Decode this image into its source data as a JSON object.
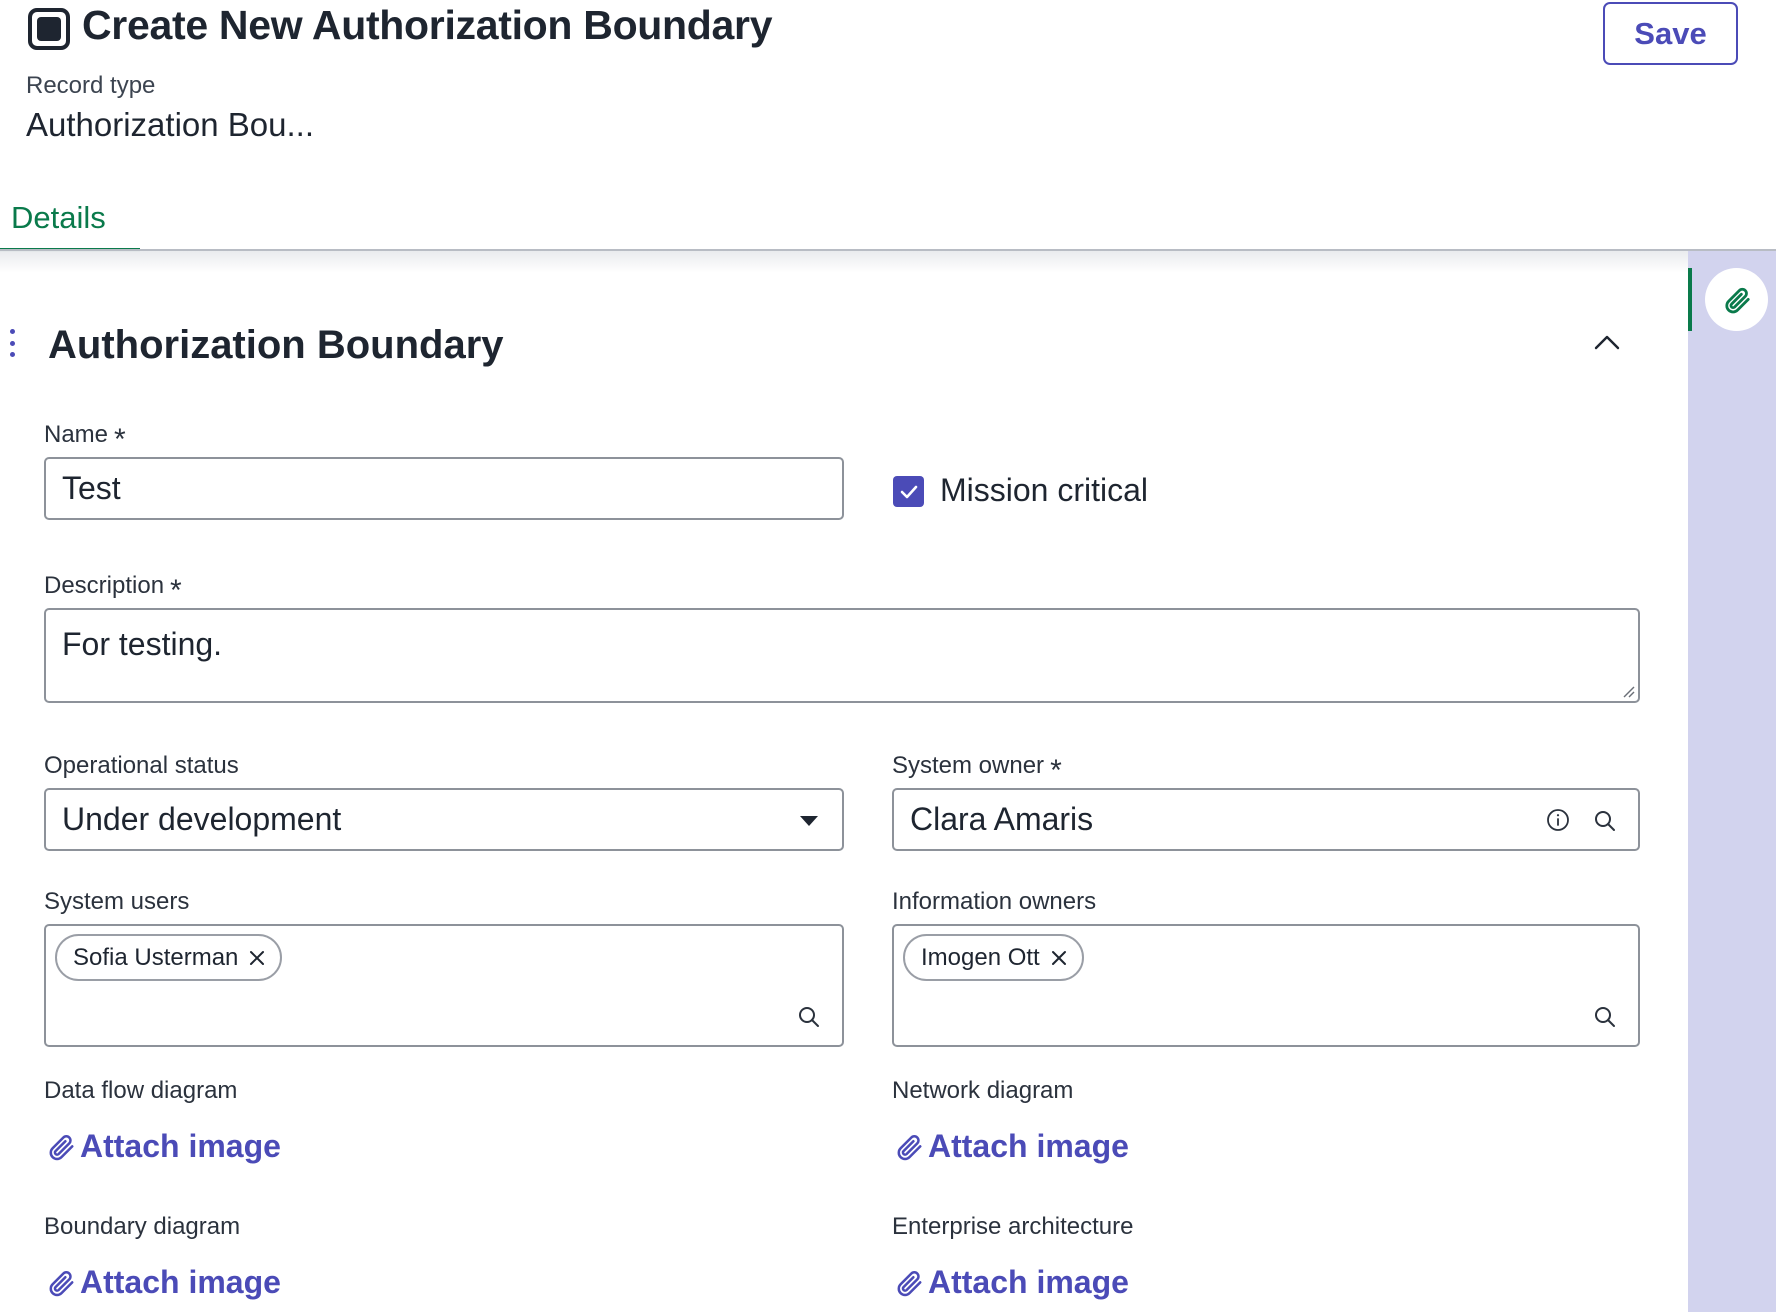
{
  "header": {
    "title": "Create New Authorization Boundary",
    "record_type_label": "Record type",
    "record_type_value": "Authorization Bou...",
    "save_label": "Save",
    "icon": "record-icon"
  },
  "tabs": [
    {
      "label": "Details",
      "active": true
    }
  ],
  "right_rail": {
    "icon": "paperclip-icon"
  },
  "section": {
    "title": "Authorization Boundary",
    "collapse_icon": "chevron-up-icon",
    "fields": {
      "name": {
        "label": "Name",
        "required_mark": "*",
        "value": "Test"
      },
      "mission_critical": {
        "label": "Mission critical",
        "checked": true
      },
      "description": {
        "label": "Description",
        "required_mark": "*",
        "value": "For testing."
      },
      "operational_status": {
        "label": "Operational status",
        "value": "Under development"
      },
      "system_owner": {
        "label": "System owner",
        "required_mark": "*",
        "value": "Clara Amaris"
      },
      "system_users": {
        "label": "System users",
        "chips": [
          "Sofia Usterman"
        ]
      },
      "information_owners": {
        "label": "Information owners",
        "chips": [
          "Imogen Ott"
        ]
      },
      "data_flow_diagram": {
        "label": "Data flow diagram",
        "action": "Attach image"
      },
      "network_diagram": {
        "label": "Network diagram",
        "action": "Attach image"
      },
      "boundary_diagram": {
        "label": "Boundary diagram",
        "action": "Attach image"
      },
      "enterprise_architecture": {
        "label": "Enterprise architecture",
        "action": "Attach image"
      }
    }
  },
  "colors": {
    "accent": "#4b4bb7",
    "tab_active": "#0a7a4b",
    "rail_background": "#d2d3ee",
    "text": "#1e2530"
  }
}
